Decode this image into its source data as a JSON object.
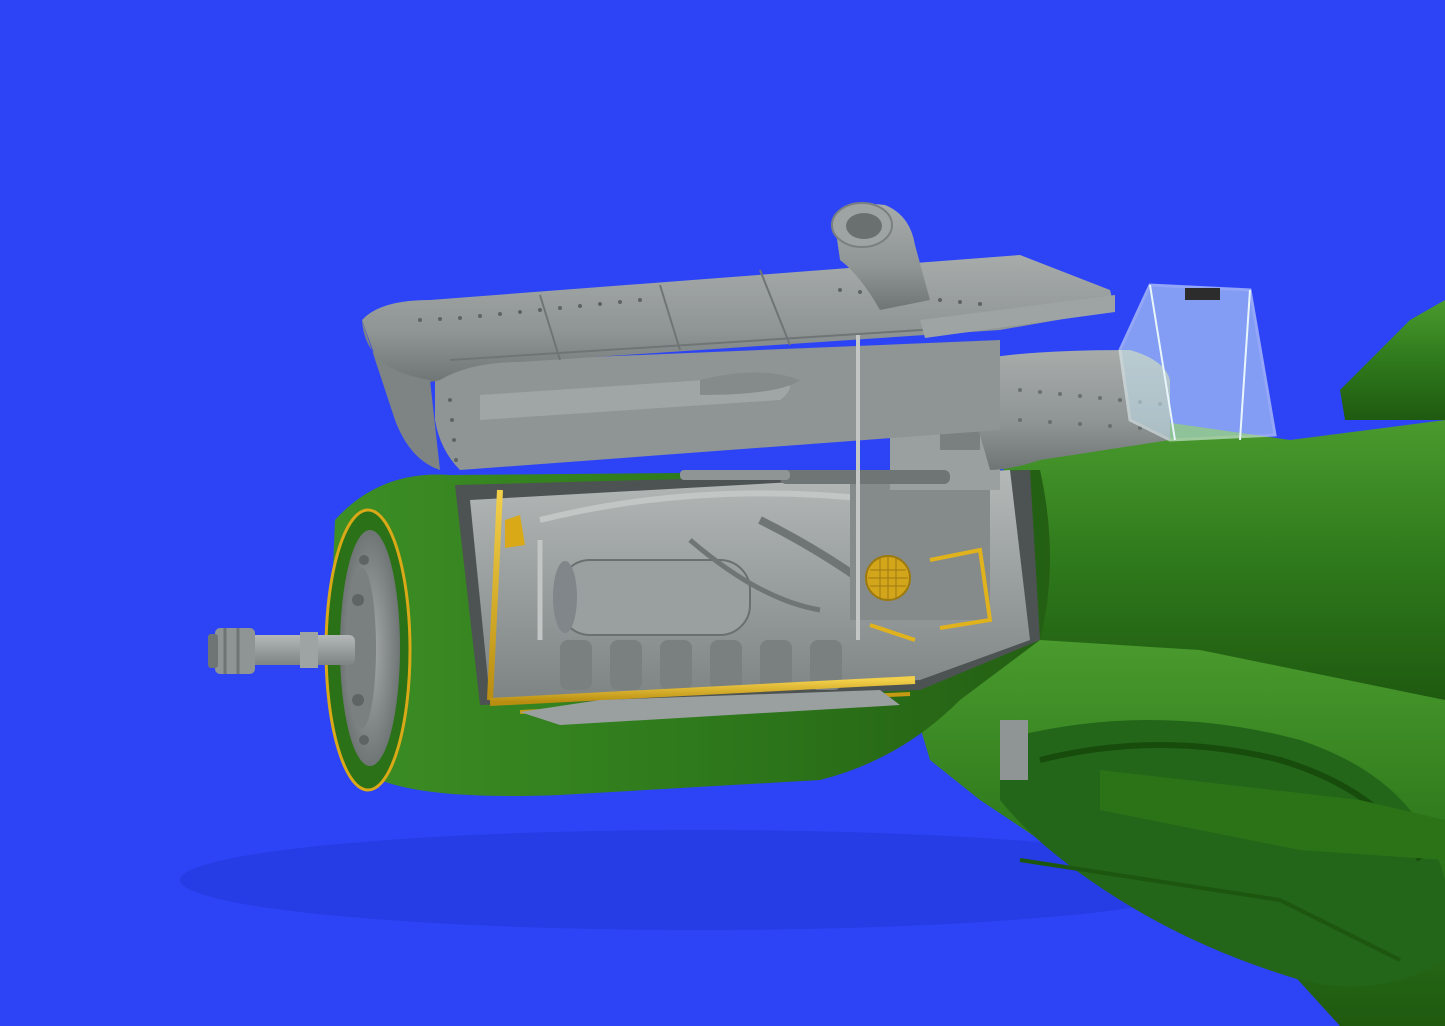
{
  "scene": {
    "subject": "aircraft-engine-render",
    "colors": {
      "background": "#2c44f6",
      "fuselage_green": "#2f7a1c",
      "fuselage_green_dark": "#1f5a10",
      "fuselage_green_light": "#4a9a2e",
      "grey_part": "#8f9494",
      "grey_part_light": "#b4b9b8",
      "grey_part_dark": "#5e6464",
      "photo_etch_brass": "#e0b21c",
      "canopy_clear": "#c9e6f2"
    },
    "icons": [
      "engine-block-icon",
      "propeller-shaft-icon",
      "engine-cowling-icon",
      "air-intake-icon",
      "canopy-icon",
      "photo-etch-frame-icon"
    ]
  }
}
